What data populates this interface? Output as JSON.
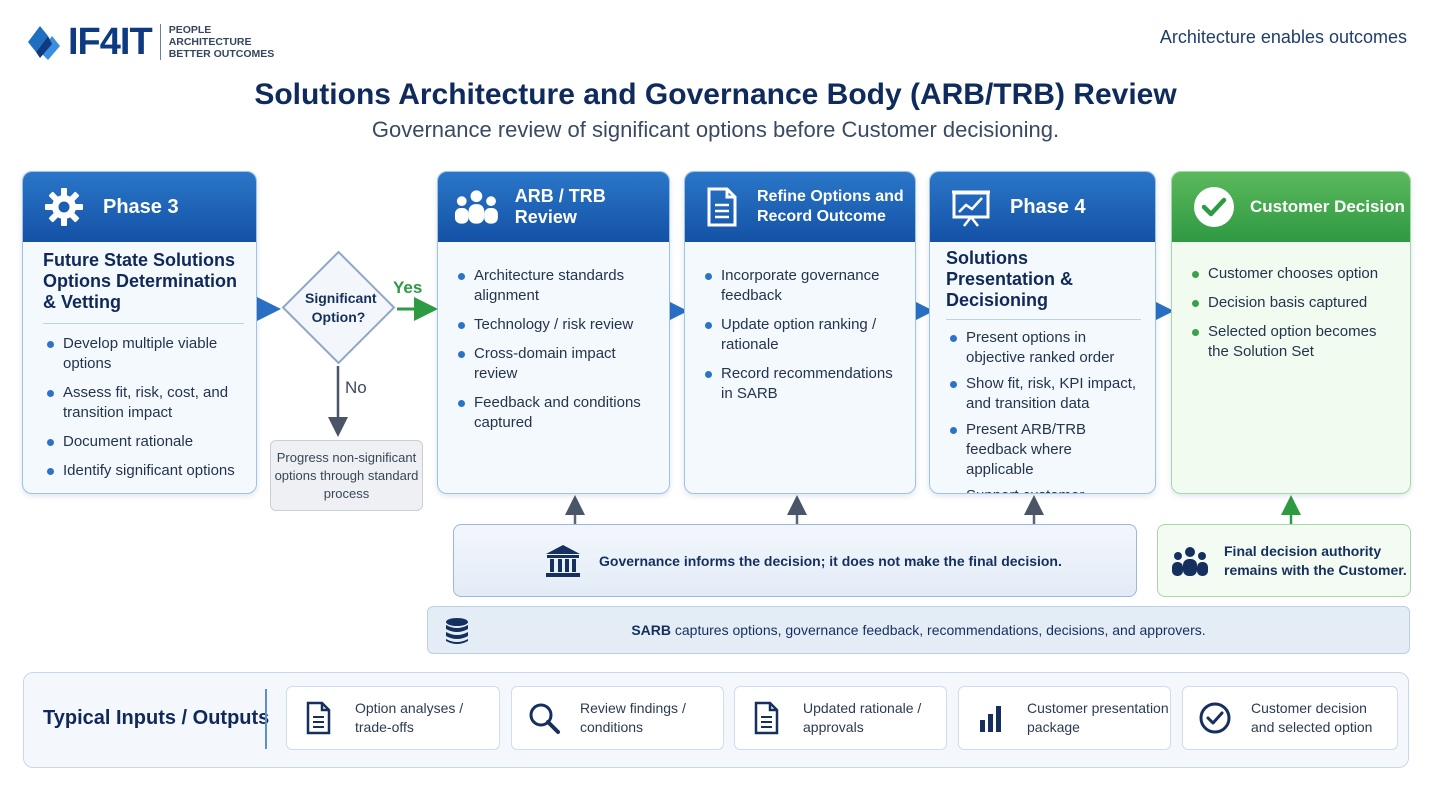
{
  "brand": {
    "name": "IF4IT",
    "tagline_lines": [
      "PEOPLE",
      "ARCHITECTURE",
      "BETTER OUTCOMES"
    ],
    "top_right": "Architecture enables outcomes"
  },
  "title": "Solutions Architecture and Governance Body (ARB/TRB) Review",
  "subtitle": "Governance review of significant options before Customer decisioning.",
  "phase3": {
    "header": "Phase 3",
    "icon": "gear-icon",
    "subhead": "Future State Solutions Options Determination & Vetting",
    "bullets": [
      "Develop multiple viable options",
      "Assess fit, risk, cost, and transition impact",
      "Document rationale",
      "Identify significant options"
    ]
  },
  "decision": {
    "question": "Significant Option?",
    "yes": "Yes",
    "no": "No",
    "no_path": "Progress non-significant options through standard process"
  },
  "arb": {
    "header": "ARB / TRB Review",
    "icon": "people-group-icon",
    "bullets": [
      "Architecture standards alignment",
      "Technology / risk review",
      "Cross-domain impact review",
      "Feedback and conditions captured"
    ]
  },
  "refine": {
    "header": "Refine Options and Record Outcome",
    "icon": "document-icon",
    "bullets": [
      "Incorporate governance feedback",
      "Update option ranking / rationale",
      "Record recommendations in SARB"
    ]
  },
  "phase4": {
    "header": "Phase 4",
    "icon": "presentation-icon",
    "subhead": "Solutions Presentation & Decisioning",
    "bullets": [
      "Present options in objective ranked order",
      "Show fit, risk, KPI impact, and transition data",
      "Present ARB/TRB feedback where applicable",
      "Support customer discussion"
    ]
  },
  "customer": {
    "header": "Customer Decision",
    "icon": "check-circle-icon",
    "bullets": [
      "Customer chooses option",
      "Decision basis captured",
      "Selected option becomes the Solution Set"
    ]
  },
  "governance_note": "Governance informs the decision; it does not make the final decision.",
  "authority_note": "Final decision authority remains with the Customer.",
  "sarb": {
    "bold": "SARB",
    "rest": " captures options, governance feedback, recommendations, decisions, and approvers."
  },
  "io": {
    "label": "Typical Inputs / Outputs",
    "items": [
      {
        "text": "Option analyses / trade-offs",
        "icon": "document-icon"
      },
      {
        "text": "Review findings / conditions",
        "icon": "magnifier-icon"
      },
      {
        "text": "Updated rationale / approvals",
        "icon": "document-icon"
      },
      {
        "text": "Customer presentation package",
        "icon": "bar-chart-icon"
      },
      {
        "text": "Customer decision and selected option",
        "icon": "check-circle-icon"
      }
    ]
  },
  "colors": {
    "primary_blue": "#1f64b8",
    "accent_green": "#37a24a",
    "title_navy": "#0f2a5c"
  }
}
